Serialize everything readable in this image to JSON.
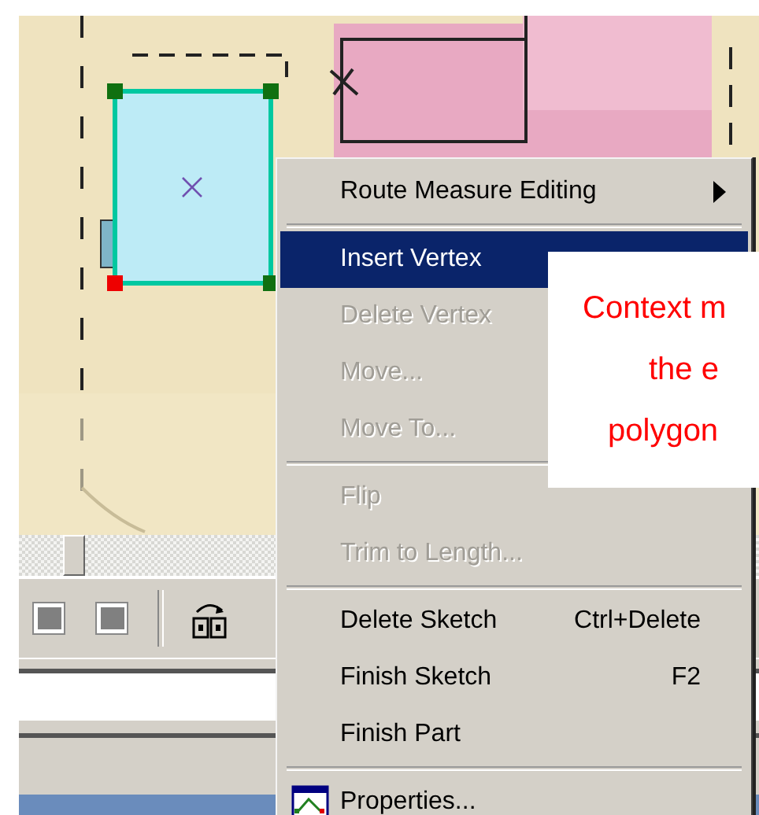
{
  "toolbar": {
    "buttons": [
      {
        "kind": "square"
      },
      {
        "kind": "square"
      },
      {
        "kind": "separator"
      },
      {
        "kind": "swap"
      }
    ]
  },
  "context_menu": {
    "items": [
      {
        "kind": "item",
        "label": "Route Measure Editing",
        "selected": false,
        "disabled": false,
        "has_submenu": true
      },
      {
        "kind": "separator"
      },
      {
        "kind": "item",
        "label": "Insert Vertex",
        "selected": true,
        "disabled": false
      },
      {
        "kind": "item",
        "label": "Delete Vertex",
        "selected": false,
        "disabled": true
      },
      {
        "kind": "item",
        "label": "Move...",
        "selected": false,
        "disabled": true
      },
      {
        "kind": "item",
        "label": "Move To...",
        "selected": false,
        "disabled": true
      },
      {
        "kind": "separator"
      },
      {
        "kind": "item",
        "label": "Flip",
        "selected": false,
        "disabled": true
      },
      {
        "kind": "item",
        "label": "Trim to Length...",
        "selected": false,
        "disabled": true
      },
      {
        "kind": "separator"
      },
      {
        "kind": "item",
        "label": "Delete Sketch",
        "shortcut": "Ctrl+Delete",
        "selected": false,
        "disabled": false
      },
      {
        "kind": "item",
        "label": "Finish Sketch",
        "shortcut": "F2",
        "selected": false,
        "disabled": false
      },
      {
        "kind": "item",
        "label": "Finish Part",
        "selected": false,
        "disabled": false
      },
      {
        "kind": "separator"
      },
      {
        "kind": "item",
        "label": "Properties...",
        "selected": false,
        "disabled": false,
        "has_icon": true
      }
    ]
  },
  "callout": {
    "lines": [
      "Context m",
      "the e",
      "polygon"
    ]
  }
}
